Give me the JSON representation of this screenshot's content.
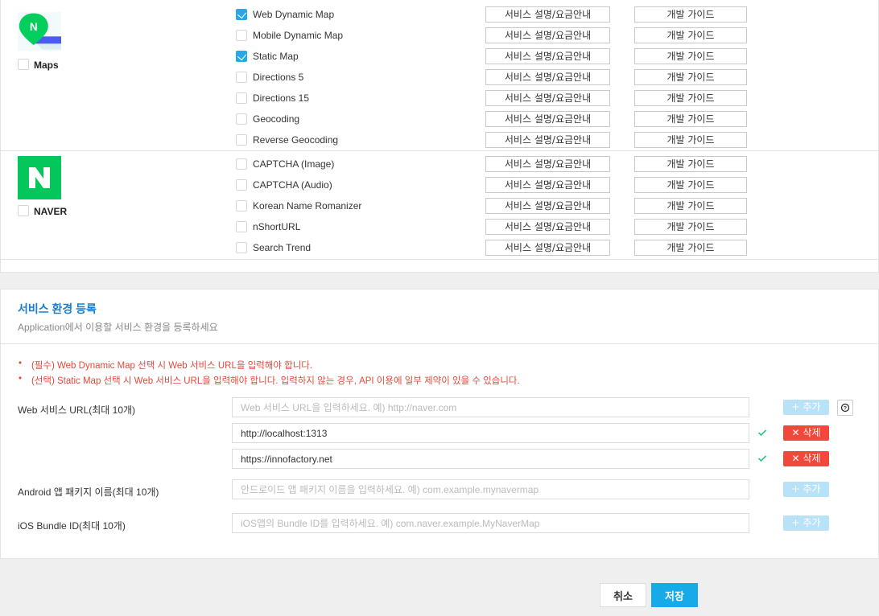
{
  "groups": [
    {
      "name": "Maps",
      "checked": false,
      "services": [
        {
          "label": "Web Dynamic Map",
          "checked": true
        },
        {
          "label": "Mobile Dynamic Map",
          "checked": false
        },
        {
          "label": "Static Map",
          "checked": true
        },
        {
          "label": "Directions 5",
          "checked": false
        },
        {
          "label": "Directions 15",
          "checked": false
        },
        {
          "label": "Geocoding",
          "checked": false
        },
        {
          "label": "Reverse Geocoding",
          "checked": false
        }
      ]
    },
    {
      "name": "NAVER",
      "checked": false,
      "services": [
        {
          "label": "CAPTCHA (Image)",
          "checked": false
        },
        {
          "label": "CAPTCHA (Audio)",
          "checked": false
        },
        {
          "label": "Korean Name Romanizer",
          "checked": false
        },
        {
          "label": "nShortURL",
          "checked": false
        },
        {
          "label": "Search Trend",
          "checked": false
        }
      ]
    }
  ],
  "service_buttons": {
    "desc_label": "서비스 설명/요금안내",
    "guide_label": "개발 가이드"
  },
  "env": {
    "title": "서비스 환경 등록",
    "subtitle": "Application에서 이용할 서비스 환경을 등록하세요",
    "notices": [
      "(필수) Web Dynamic Map 선택 시 Web 서비스 URL을 입력해야 합니다.",
      "(선택) Static Map 선택 시 Web 서비스 URL을 입력해야 합니다. 입력하지 않는 경우, API 이용에 일부 제약이 있을 수 있습니다."
    ],
    "web_url": {
      "label": "Web 서비스 URL(최대 10개)",
      "placeholder": "Web 서비스 URL을 입력하세요. 예) http://naver.com",
      "entries": [
        "http://localhost:1313",
        "https://innofactory.net"
      ]
    },
    "android": {
      "label": "Android 앱 패키지 이름(최대 10개)",
      "placeholder": "안드로이드 앱 패키지 이름을 입력하세요. 예) com.example.mynavermap"
    },
    "ios": {
      "label": "iOS Bundle ID(최대 10개)",
      "placeholder": "iOS앱의 Bundle ID를 입력하세요. 예) com.naver.example.MyNaverMap"
    },
    "add_label": "추가",
    "delete_label": "삭제"
  },
  "footer": {
    "cancel_label": "취소",
    "save_label": "저장"
  },
  "colors": {
    "accent": "#16abe8",
    "danger": "#f2473a",
    "notice": "#e2493a",
    "title": "#1a7ed0",
    "naver_green": "#03c75a"
  }
}
